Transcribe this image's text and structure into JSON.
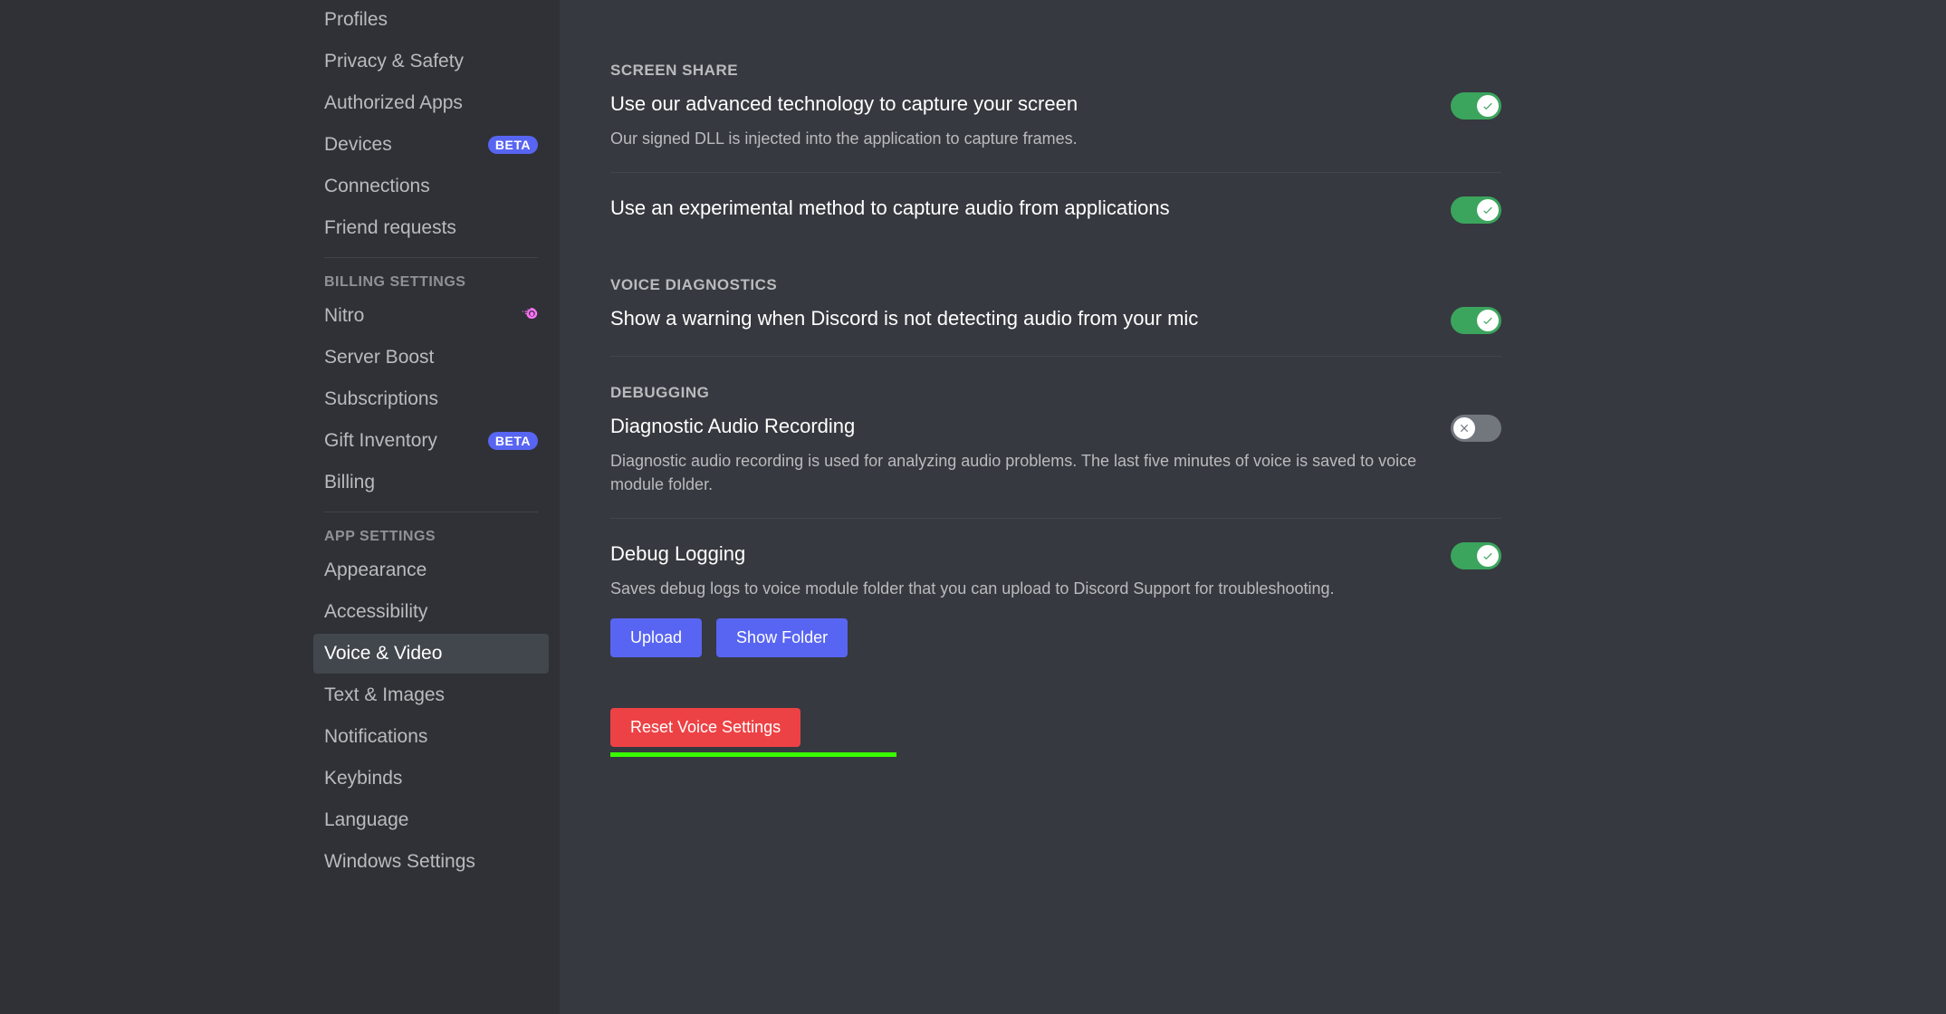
{
  "sidebar": {
    "user_items": [
      {
        "label": "Profiles",
        "badge": null
      },
      {
        "label": "Privacy & Safety",
        "badge": null
      },
      {
        "label": "Authorized Apps",
        "badge": null
      },
      {
        "label": "Devices",
        "badge": "BETA"
      },
      {
        "label": "Connections",
        "badge": null
      },
      {
        "label": "Friend requests",
        "badge": null
      }
    ],
    "billing_header": "Billing Settings",
    "billing_items": [
      {
        "label": "Nitro",
        "icon": "nitro"
      },
      {
        "label": "Server Boost",
        "badge": null
      },
      {
        "label": "Subscriptions",
        "badge": null
      },
      {
        "label": "Gift Inventory",
        "badge": "BETA"
      },
      {
        "label": "Billing",
        "badge": null
      }
    ],
    "app_header": "App Settings",
    "app_items": [
      {
        "label": "Appearance",
        "active": false
      },
      {
        "label": "Accessibility",
        "active": false
      },
      {
        "label": "Voice & Video",
        "active": true
      },
      {
        "label": "Text & Images",
        "active": false
      },
      {
        "label": "Notifications",
        "active": false
      },
      {
        "label": "Keybinds",
        "active": false
      },
      {
        "label": "Language",
        "active": false
      },
      {
        "label": "Windows Settings",
        "active": false
      }
    ]
  },
  "sections": {
    "screen_share": {
      "header": "Screen Share",
      "items": [
        {
          "title": "Use our advanced technology to capture your screen",
          "desc": "Our signed DLL is injected into the application to capture frames.",
          "on": true
        },
        {
          "title": "Use an experimental method to capture audio from applications",
          "desc": "",
          "on": true
        }
      ]
    },
    "voice_diagnostics": {
      "header": "Voice Diagnostics",
      "items": [
        {
          "title": "Show a warning when Discord is not detecting audio from your mic",
          "desc": "",
          "on": true
        }
      ]
    },
    "debugging": {
      "header": "Debugging",
      "items": [
        {
          "title": "Diagnostic Audio Recording",
          "desc": "Diagnostic audio recording is used for analyzing audio problems. The last five minutes of voice is saved to voice module folder.",
          "on": false
        },
        {
          "title": "Debug Logging",
          "desc": "Saves debug logs to voice module folder that you can upload to Discord Support for troubleshooting.",
          "on": true
        }
      ]
    }
  },
  "buttons": {
    "upload": "Upload",
    "show_folder": "Show Folder",
    "reset": "Reset Voice Settings"
  }
}
